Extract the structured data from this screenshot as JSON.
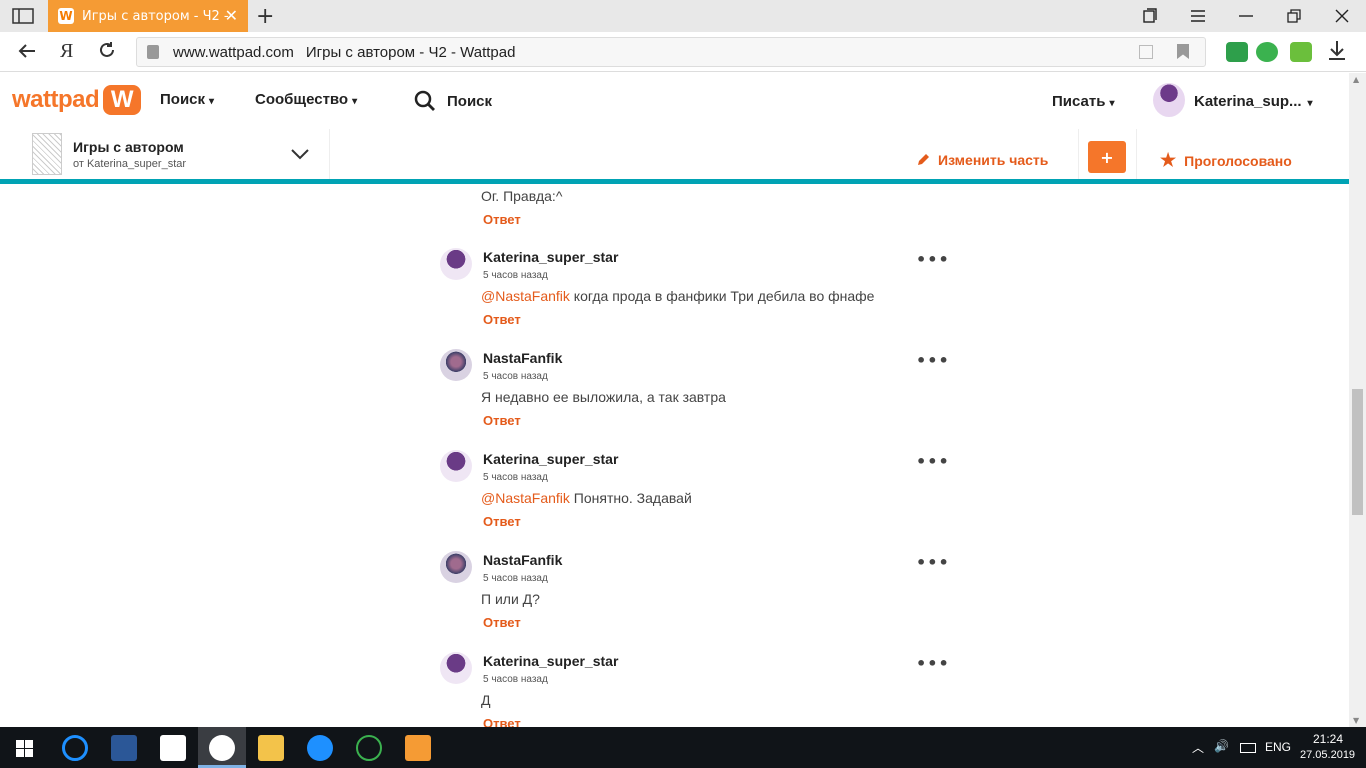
{
  "browser": {
    "tab_title": "Игры с автором - Ч2 -",
    "tab_favicon": "W",
    "tab_close": "✕",
    "new_tab": "+",
    "address_domain": "www.wattpad.com",
    "address_title": "Игры с автором - Ч2 - Wattpad",
    "yandex_button": "Я"
  },
  "header": {
    "logo_text": "wattpad",
    "logo_mark": "W",
    "nav_search": "Поиск",
    "nav_community": "Сообщество",
    "search_label": "Поиск",
    "write_label": "Писать",
    "username": "Katerina_sup...",
    "caret": "▾"
  },
  "story": {
    "title": "Игры с автором",
    "by": "от Katerina_super_star",
    "edit_part": "Изменить часть",
    "plus": "+",
    "voted": "Проголосовано"
  },
  "top_fragment": {
    "text": "Ог. Правда:^",
    "reply": "Ответ"
  },
  "comments": [
    {
      "author": "Katerina_super_star",
      "time": "5 часов назад",
      "mention": "@NastaFanfik",
      "text": "  когда прода в фанфики Три дебила во фнафе",
      "reply": "Ответ",
      "more": "•••"
    },
    {
      "author": "NastaFanfik",
      "time": "5 часов назад",
      "mention": "",
      "text": "Я недавно ее выложила, а так завтра",
      "reply": "Ответ",
      "more": "•••"
    },
    {
      "author": "Katerina_super_star",
      "time": "5 часов назад",
      "mention": "@NastaFanfik",
      "text": " Понятно. Задавай",
      "reply": "Ответ",
      "more": "•••"
    },
    {
      "author": "NastaFanfik",
      "time": "5 часов назад",
      "mention": "",
      "text": "П или Д?",
      "reply": "Ответ",
      "more": "•••"
    },
    {
      "author": "Katerina_super_star",
      "time": "5 часов назад",
      "mention": "",
      "text": "Д",
      "reply": "Ответ",
      "more": "•••"
    }
  ],
  "taskbar": {
    "lang": "ENG",
    "time": "21:24",
    "date": "27.05.2019"
  },
  "colors": {
    "accent": "#f5762a",
    "link": "#e45b1b",
    "teal": "#00a3b4"
  }
}
